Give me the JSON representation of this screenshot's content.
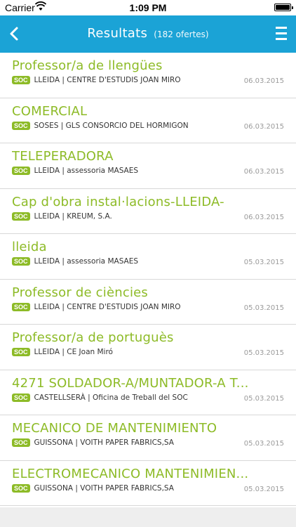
{
  "statusbar": {
    "carrier": "Carrier",
    "time": "1:09 PM"
  },
  "navbar": {
    "title": "Resultats",
    "subtitle": "(182 ofertes)"
  },
  "badge": "SOC",
  "items": [
    {
      "job": "Professor/a de llengües",
      "meta": "LLEIDA | CENTRE D'ESTUDIS JOAN MIRO",
      "date": "06.03.2015"
    },
    {
      "job": "COMERCIAL",
      "meta": "SOSES | GLS CONSORCIO DEL HORMIGON",
      "date": "06.03.2015"
    },
    {
      "job": "TELEPERADORA",
      "meta": "LLEIDA | assessoria MASAES",
      "date": "06.03.2015"
    },
    {
      "job": "Cap d'obra instal·lacions-LLEIDA-",
      "meta": "LLEIDA | KREUM, S.A.",
      "date": "06.03.2015"
    },
    {
      "job": "lleida",
      "meta": "LLEIDA | assessoria MASAES",
      "date": "05.03.2015"
    },
    {
      "job": "Professor de ciències",
      "meta": "LLEIDA | CENTRE D'ESTUDIS JOAN MIRO",
      "date": "05.03.2015"
    },
    {
      "job": "Professor/a de portuguès",
      "meta": "LLEIDA | CE Joan Miró",
      "date": "05.03.2015"
    },
    {
      "job": "4271 SOLDADOR-A/MUNTADOR-A T...",
      "meta": "CASTELLSERÀ | Oficina de Treball del SOC",
      "date": "05.03.2015"
    },
    {
      "job": "MECANICO DE MANTENIMIENTO",
      "meta": "GUISSONA | VOITH PAPER FABRICS,SA",
      "date": "05.03.2015"
    },
    {
      "job": "ELECTROMECANICO MANTENIMIEN...",
      "meta": "GUISSONA | VOITH PAPER FABRICS,SA",
      "date": "05.03.2015"
    }
  ]
}
